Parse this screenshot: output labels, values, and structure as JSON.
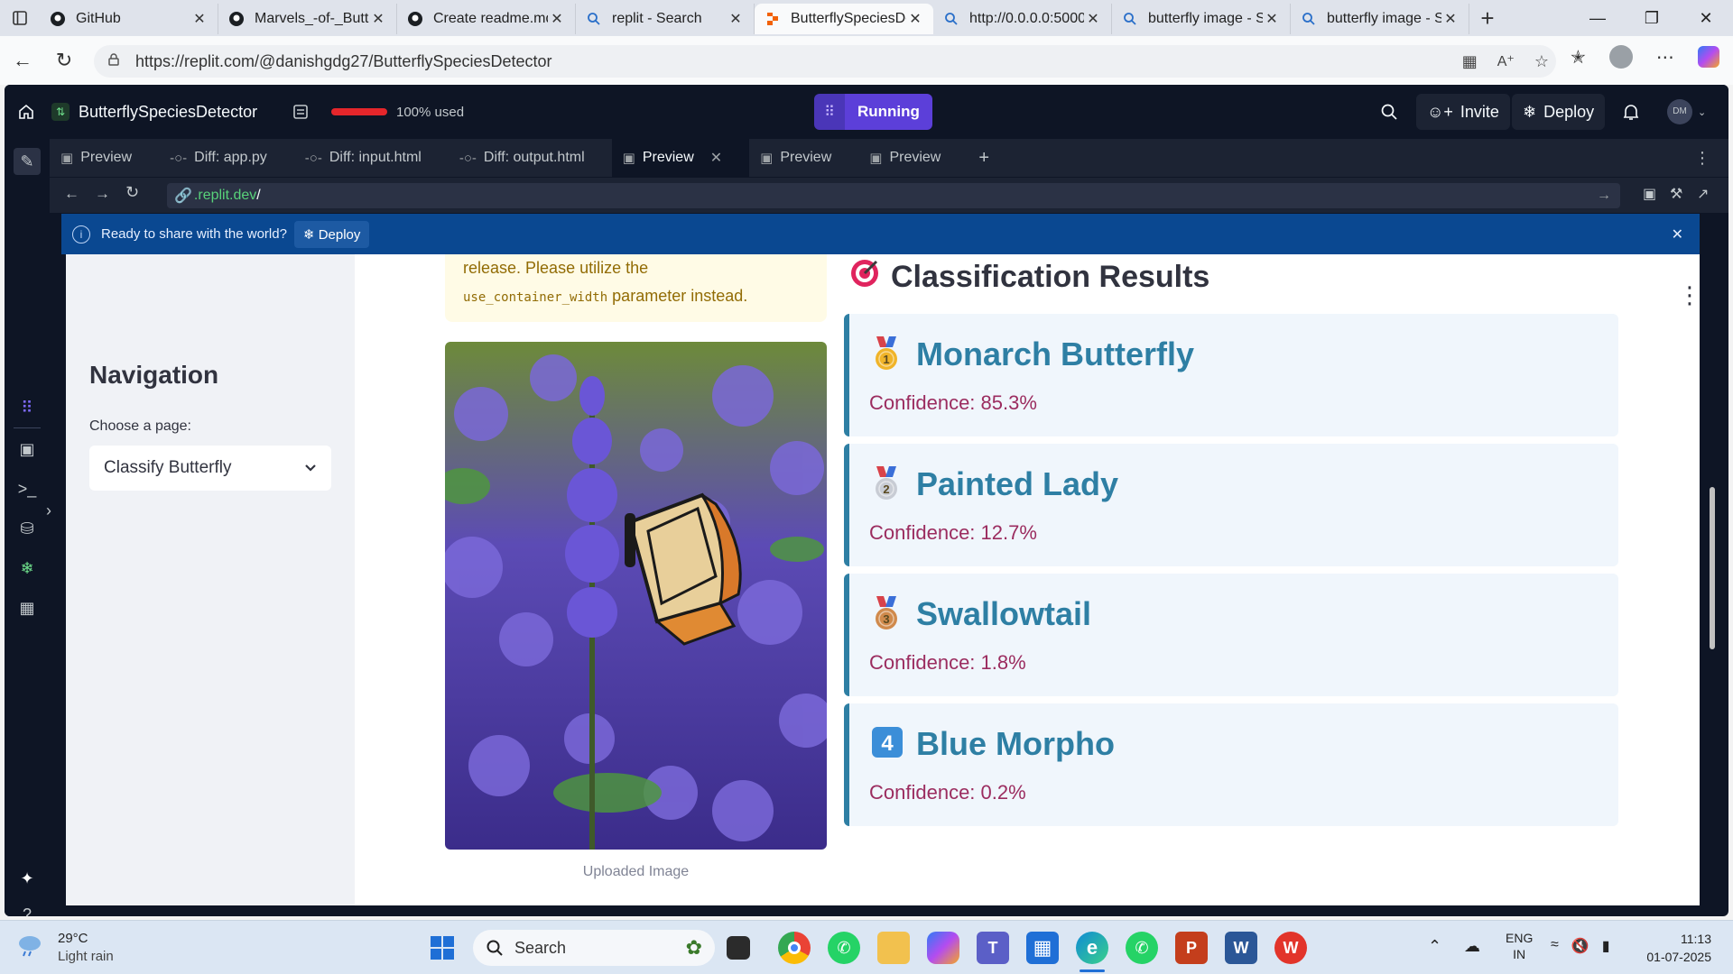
{
  "browser": {
    "tabs": [
      {
        "title": "GitHub",
        "icon": "github-icon"
      },
      {
        "title": "Marvels_-of-_Butte",
        "icon": "github-icon"
      },
      {
        "title": "Create readme.md",
        "icon": "github-icon"
      },
      {
        "title": "replit - Search",
        "icon": "search-icon"
      },
      {
        "title": "ButterflySpeciesDe",
        "icon": "replit-icon",
        "active": true
      },
      {
        "title": "http://0.0.0.0:5000",
        "icon": "search-icon"
      },
      {
        "title": "butterfly image - S",
        "icon": "search-icon"
      },
      {
        "title": "butterfly image - S",
        "icon": "search-icon"
      }
    ],
    "url": "https://replit.com/@danishgdg27/ButterflySpeciesDetector"
  },
  "replit": {
    "project_name": "ButterflySpeciesDetector",
    "usage_text": "100% used",
    "usage_fraction": 1.0,
    "run_label": "Running",
    "invite_label": "Invite",
    "deploy_label": "Deploy",
    "avatar_initials": "DM",
    "editor_tabs": [
      {
        "label": "Preview",
        "icon": "monitor-icon"
      },
      {
        "label": "Diff: app.py",
        "icon": "diff-icon"
      },
      {
        "label": "Diff: input.html",
        "icon": "diff-icon"
      },
      {
        "label": "Diff: output.html",
        "icon": "diff-icon"
      },
      {
        "label": "Preview",
        "icon": "monitor-icon",
        "active": true
      },
      {
        "label": "Preview",
        "icon": "monitor-icon"
      },
      {
        "label": "Preview",
        "icon": "monitor-icon"
      }
    ],
    "preview_url_prefix": ".replit.dev",
    "preview_url_suffix": "/",
    "banner_text": "Ready to share with the world?",
    "banner_button": "Deploy"
  },
  "app": {
    "sidebar": {
      "title": "Navigation",
      "select_label": "Choose a page:",
      "select_value": "Classify Butterfly"
    },
    "warning_line1": "release. Please utilize the",
    "warning_code": "use_container_width",
    "warning_line2": "parameter instead.",
    "image_caption": "Uploaded Image",
    "results_title": "Classification Results",
    "results": [
      {
        "rank": "1",
        "name": "Monarch Butterfly",
        "confidence": "Confidence: 85.3%",
        "medal": "gold"
      },
      {
        "rank": "2",
        "name": "Painted Lady",
        "confidence": "Confidence: 12.7%",
        "medal": "silver"
      },
      {
        "rank": "3",
        "name": "Swallowtail",
        "confidence": "Confidence: 1.8%",
        "medal": "bronze"
      },
      {
        "rank": "4",
        "name": "Blue Morpho",
        "confidence": "Confidence: 0.2%",
        "medal": "keycap"
      }
    ]
  },
  "taskbar": {
    "weather_temp": "29°C",
    "weather_desc": "Light rain",
    "search_placeholder": "Search",
    "lang1": "ENG",
    "lang2": "IN",
    "time": "11:13",
    "date": "01-07-2025"
  },
  "colors": {
    "replit_bg": "#0e1525",
    "run_purple": "#5c3fd9",
    "banner_blue": "#0a4891",
    "result_blue": "#2e7fa4",
    "confidence_red": "#9b2c5f"
  }
}
